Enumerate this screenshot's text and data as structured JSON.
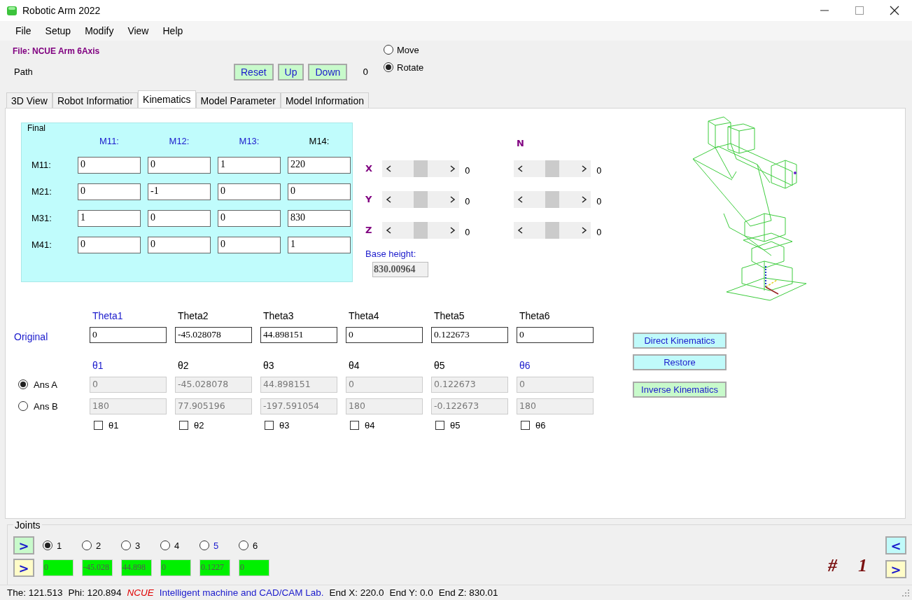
{
  "window": {
    "title": "Robotic Arm 2022"
  },
  "menu": [
    "File",
    "Setup",
    "Modify",
    "View",
    "Help"
  ],
  "file_label": "File: NCUE Arm 6Axis",
  "path": {
    "label": "Path",
    "buttons": [
      "Reset",
      "Up",
      "Down"
    ],
    "count": "0"
  },
  "mode_options": [
    {
      "label": "Move",
      "selected": false
    },
    {
      "label": "Rotate",
      "selected": true
    }
  ],
  "tabs": [
    {
      "label": "3D View",
      "selected": false
    },
    {
      "label": "Robot Informatior",
      "selected": false
    },
    {
      "label": "Kinematics",
      "selected": true
    },
    {
      "label": "Model Parameter",
      "selected": false
    },
    {
      "label": "Model Information",
      "selected": false
    }
  ],
  "final_matrix": {
    "title": "Final",
    "columns": [
      {
        "label": "M11:",
        "highlighted": true
      },
      {
        "label": "M12:",
        "highlighted": true
      },
      {
        "label": "M13:",
        "highlighted": true
      },
      {
        "label": "M14:",
        "highlighted": false
      }
    ],
    "rows": [
      {
        "label": "M11:",
        "values": [
          "0",
          "0",
          "1",
          "220"
        ]
      },
      {
        "label": "M21:",
        "values": [
          "0",
          "-1",
          "0",
          "0"
        ]
      },
      {
        "label": "M31:",
        "values": [
          "1",
          "0",
          "0",
          "830"
        ]
      },
      {
        "label": "M41:",
        "values": [
          "0",
          "0",
          "0",
          "1"
        ]
      }
    ]
  },
  "position_sliders": [
    {
      "axis": "X",
      "level": 0.5,
      "reading": "0"
    },
    {
      "axis": "Y",
      "level": 0.5,
      "reading": "0"
    },
    {
      "axis": "Z",
      "level": 0.5,
      "reading": "0"
    }
  ],
  "orientation": {
    "title": "N",
    "sliders": [
      {
        "level": 0.5,
        "reading": "0"
      },
      {
        "level": 0.5,
        "reading": "0"
      },
      {
        "level": 0.5,
        "reading": "0"
      }
    ]
  },
  "base_height": {
    "label": "Base height:",
    "value": "830.00964"
  },
  "kinematics": {
    "columns": [
      {
        "label": "Theta1",
        "highlighted": true
      },
      {
        "label": "Theta2",
        "highlighted": false
      },
      {
        "label": "Theta3",
        "highlighted": false
      },
      {
        "label": "Theta4",
        "highlighted": false
      },
      {
        "label": "Theta5",
        "highlighted": false
      },
      {
        "label": "Theta6",
        "highlighted": false
      }
    ],
    "original": {
      "label": "Original",
      "values": [
        "0",
        "-45.028078",
        "44.898151",
        "0",
        "0.122673",
        "0"
      ]
    },
    "angle_headers": [
      {
        "label": "θ1",
        "highlighted": true
      },
      {
        "label": "θ2",
        "highlighted": false
      },
      {
        "label": "θ3",
        "highlighted": false
      },
      {
        "label": "θ4",
        "highlighted": false
      },
      {
        "label": "θ5",
        "highlighted": false
      },
      {
        "label": "θ6",
        "highlighted": true
      }
    ],
    "answers": [
      {
        "label": "Ans A",
        "selected": true,
        "values": [
          "0",
          "-45.028078",
          "44.898151",
          "0",
          "0.122673",
          "0"
        ]
      },
      {
        "label": "Ans B",
        "selected": false,
        "values": [
          "180",
          "77.905196",
          "-197.591054",
          "180",
          "-0.122673",
          "180"
        ]
      }
    ],
    "locks": [
      {
        "label": "θ1",
        "checked": false
      },
      {
        "label": "θ2",
        "checked": false
      },
      {
        "label": "θ3",
        "checked": false
      },
      {
        "label": "θ4",
        "checked": false
      },
      {
        "label": "θ5",
        "checked": false
      },
      {
        "label": "θ6",
        "checked": false
      }
    ]
  },
  "actions": [
    {
      "label": "Direct Kinematics",
      "kind": "aqua"
    },
    {
      "label": "Restore",
      "kind": "aqua"
    },
    {
      "label": "Inverse Kinematics",
      "kind": "mint"
    }
  ],
  "joints": {
    "title": "Joints",
    "left_buttons": [
      {
        "label": ">",
        "kind": "mint"
      },
      {
        "label": ">",
        "kind": "cream"
      }
    ],
    "options": [
      {
        "label": "1",
        "selected": true,
        "highlighted": false
      },
      {
        "label": "2",
        "selected": false,
        "highlighted": false
      },
      {
        "label": "3",
        "selected": false,
        "highlighted": false
      },
      {
        "label": "4",
        "selected": false,
        "highlighted": false
      },
      {
        "label": "5",
        "selected": false,
        "highlighted": true
      },
      {
        "label": "6",
        "selected": false,
        "highlighted": false
      }
    ],
    "values": [
      "0",
      "-45.028",
      "44.898",
      "0",
      "0.1227",
      "0"
    ],
    "current": {
      "hash": "#",
      "number": "1"
    },
    "right_buttons": [
      {
        "label": "<",
        "kind": "aqua"
      },
      {
        "label": ">",
        "kind": "cream"
      }
    ]
  },
  "status_bar": [
    {
      "text": "The: 121.513",
      "kind": "plain"
    },
    {
      "text": "Phi: 120.894",
      "kind": "plain"
    },
    {
      "text": "NCUE",
      "kind": "brand"
    },
    {
      "text": "Intelligent machine and CAD/CAM Lab.",
      "kind": "lab"
    },
    {
      "text": "End X: 220.0",
      "kind": "plain"
    },
    {
      "text": "End Y: 0.0",
      "kind": "plain"
    },
    {
      "text": "End Z: 830.01",
      "kind": "plain"
    }
  ]
}
